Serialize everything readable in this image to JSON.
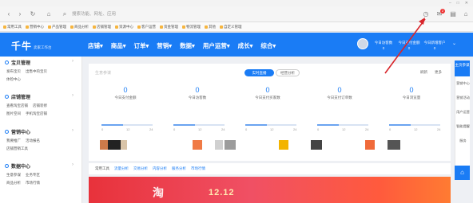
{
  "browser": {
    "address_placeholder": "搜索功能、网址、应用",
    "notif_count": "2",
    "bookmarks": [
      "常用工具",
      "营销中心",
      "产品管理",
      "商品分析",
      "店铺管理",
      "资源中心",
      "客户运营",
      "资金管理",
      "物流管理",
      "其他",
      "自定义管理"
    ]
  },
  "header": {
    "logo": "千牛",
    "logo_sub": "卖家工作台",
    "nav": [
      "店铺▾",
      "商品▾",
      "订单▾",
      "营销▾",
      "数据▾",
      "用户运营▾",
      "成长▾",
      "综合▾"
    ],
    "stats": [
      {
        "label": "今日访客数",
        "value": "0"
      },
      {
        "label": "今日支付金额",
        "value": "0"
      },
      {
        "label": "今日新增客户",
        "value": "0"
      }
    ]
  },
  "sidebar": {
    "groups": [
      {
        "title": "宝贝管理",
        "items": [
          [
            "发布宝贝",
            "出售中的宝贝"
          ],
          [
            "体检中心"
          ]
        ]
      },
      {
        "title": "店铺管理",
        "items": [
          [
            "查看淘宝店铺",
            "店铺装修"
          ],
          [
            "图片空间",
            "手机淘宝店铺"
          ]
        ]
      },
      {
        "title": "营销中心",
        "items": [
          [
            "我要推广",
            "活动报名"
          ],
          [
            "店铺营销工具"
          ]
        ]
      },
      {
        "title": "数据中心",
        "items": [
          [
            "生意参谋",
            "业务专区"
          ],
          [
            "商品分析",
            "市场行情"
          ]
        ]
      }
    ]
  },
  "main": {
    "card_title": "生意参谋",
    "tab_active": "实时直播",
    "tab_other": "经营分析",
    "action_refresh": "刷新",
    "action_more": "更多",
    "metrics": [
      {
        "value": "0",
        "label": "今日支付金额"
      },
      {
        "value": "0",
        "label": "今日访客数"
      },
      {
        "value": "0",
        "label": "今日支付买家数"
      },
      {
        "value": "0",
        "label": "今日支付订单数"
      },
      {
        "value": "0",
        "label": "今日浏览量"
      }
    ],
    "timeline_ticks": [
      "0",
      "12",
      "24"
    ],
    "subtabs": [
      "常用工具",
      "流量分析",
      "交易分析",
      "内容分析",
      "服务分析",
      "市场行情"
    ],
    "banner_text": "淘",
    "banner_text2": "12.12"
  },
  "rail": {
    "top": "主页参谋",
    "items": [
      "营销中心",
      "营销活动",
      "用户运营",
      "智能提醒",
      "服务"
    ],
    "bottom": "⌂"
  },
  "colors": {
    "brand": "#1a7cf5",
    "annotation": "#d8262c"
  }
}
